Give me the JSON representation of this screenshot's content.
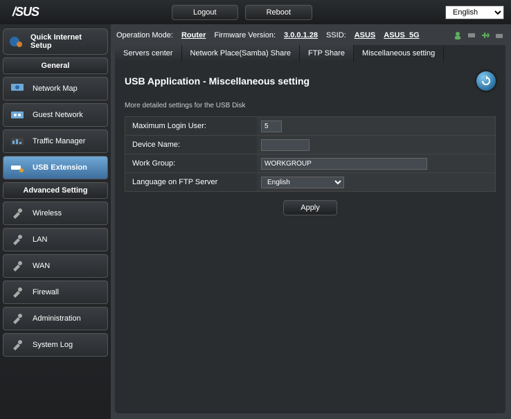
{
  "top": {
    "logo": "/SUS",
    "logout": "Logout",
    "reboot": "Reboot",
    "language": "English"
  },
  "status": {
    "opmode_label": "Operation Mode:",
    "opmode": "Router",
    "fw_label": "Firmware Version:",
    "fw": "3.0.0.1.28",
    "ssid_label": "SSID:",
    "ssid1": "ASUS",
    "ssid2": "ASUS_5G"
  },
  "sidebar": {
    "quick": "Quick Internet Setup",
    "general": "General",
    "items_general": [
      {
        "label": "Network Map",
        "icon": "🌐"
      },
      {
        "label": "Guest Network",
        "icon": "👥"
      },
      {
        "label": "Traffic Manager",
        "icon": "📊"
      },
      {
        "label": "USB Extension",
        "icon": "🔌"
      }
    ],
    "advanced": "Advanced Setting",
    "items_adv": [
      {
        "label": "Wireless"
      },
      {
        "label": "LAN"
      },
      {
        "label": "WAN"
      },
      {
        "label": "Firewall"
      },
      {
        "label": "Administration"
      },
      {
        "label": "System Log"
      }
    ]
  },
  "tabs": [
    "Servers center",
    "Network Place(Samba) Share",
    "FTP Share",
    "Miscellaneous setting"
  ],
  "panel": {
    "title": "USB Application - Miscellaneous setting",
    "subtitle": "More detailed settings for the USB Disk",
    "max_login_label": "Maximum Login User:",
    "max_login_value": "5",
    "device_name_label": "Device Name:",
    "device_name_value": "",
    "workgroup_label": "Work Group:",
    "workgroup_value": "WORKGROUP",
    "ftp_lang_label": "Language on FTP Server",
    "ftp_lang_value": "English",
    "apply": "Apply"
  }
}
